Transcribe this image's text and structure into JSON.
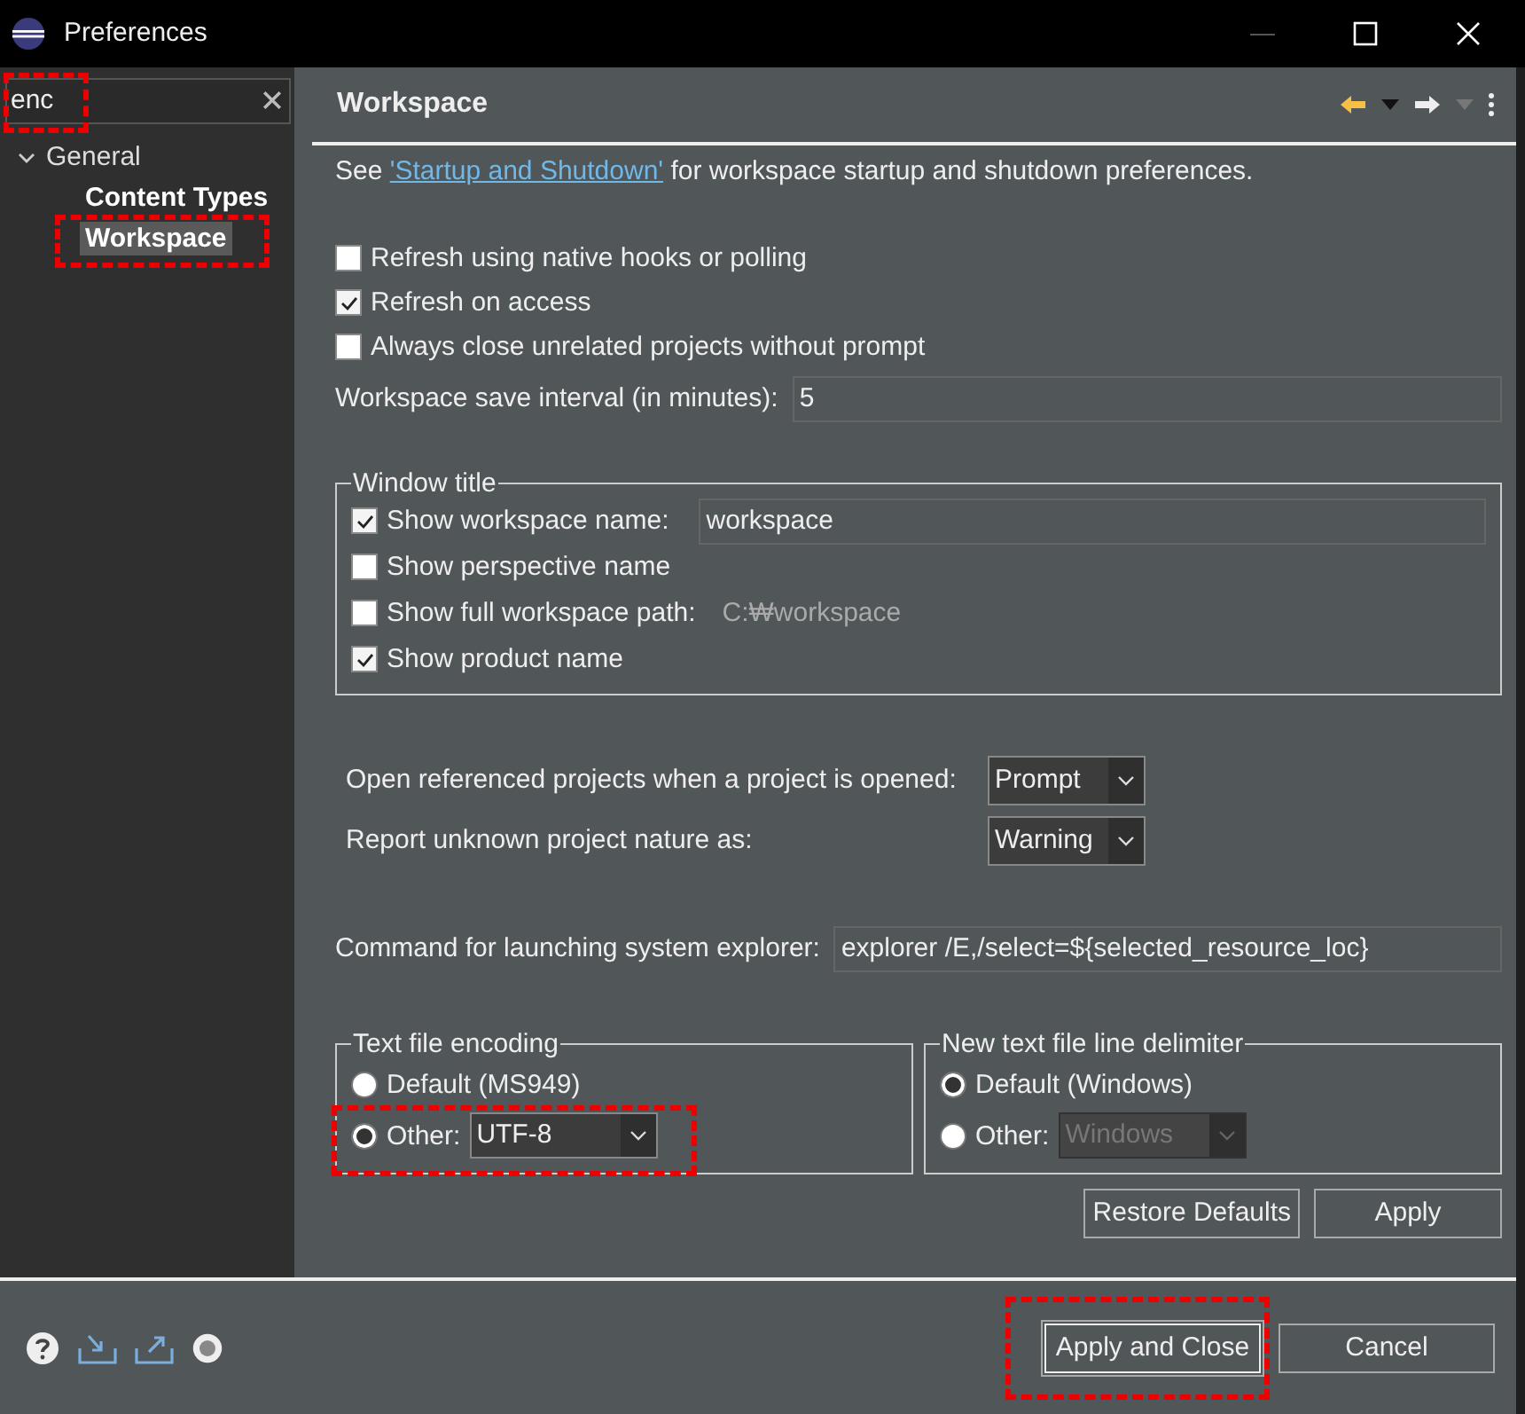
{
  "window": {
    "title": "Preferences"
  },
  "filter": {
    "value": "enc",
    "annotated": true
  },
  "tree": [
    {
      "label": "General",
      "expanded": true,
      "children": [
        {
          "label": "Content Types",
          "selected": false,
          "annotated": false
        },
        {
          "label": "Workspace",
          "selected": true,
          "annotated": true
        }
      ]
    }
  ],
  "page": {
    "title": "Workspace",
    "intro_before": "See",
    "link": "'Startup and Shutdown'",
    "intro_after": "for workspace startup and shutdown preferences."
  },
  "options": [
    {
      "label": "Refresh using native hooks or polling",
      "checked": false
    },
    {
      "label": "Refresh on access",
      "checked": true
    },
    {
      "label": "Always close unrelated projects without prompt",
      "checked": false
    }
  ],
  "save_interval": {
    "label": "Workspace save interval (in minutes):",
    "value": "5"
  },
  "window_title": {
    "legend": "Window title",
    "rows": [
      {
        "kind": "checkbox-field",
        "label": "Show workspace name:",
        "checked": true,
        "value": "workspace"
      },
      {
        "kind": "checkbox",
        "label": "Show perspective name",
        "checked": false
      },
      {
        "kind": "checkbox-hint",
        "label": "Show full workspace path:",
        "checked": false,
        "hint": "C:₩workspace"
      },
      {
        "kind": "checkbox",
        "label": "Show product name",
        "checked": true
      }
    ]
  },
  "dropdowns": [
    {
      "label": "Open referenced projects when a project is opened:",
      "value": "Prompt"
    },
    {
      "label": "Report unknown project nature as:",
      "value": "Warning"
    }
  ],
  "explorer_command": {
    "label": "Command for launching system explorer:",
    "value": "explorer /E,/select=${selected_resource_loc}"
  },
  "encoding": {
    "legend": "Text file encoding",
    "options": [
      {
        "label": "Default (MS949)",
        "selected": false
      },
      {
        "label": "Other:",
        "selected": true,
        "value": "UTF-8",
        "disabled": false,
        "annotated": true
      }
    ]
  },
  "delimiter": {
    "legend": "New text file line delimiter",
    "options": [
      {
        "label": "Default (Windows)",
        "selected": true
      },
      {
        "label": "Other:",
        "selected": false,
        "value": "Windows",
        "disabled": true,
        "annotated": false
      }
    ]
  },
  "page_buttons": [
    "Restore Defaults",
    "Apply"
  ],
  "footer_buttons": [
    {
      "label": "Apply and Close",
      "default": true,
      "annotated": true
    },
    {
      "label": "Cancel",
      "default": false,
      "annotated": false
    }
  ]
}
